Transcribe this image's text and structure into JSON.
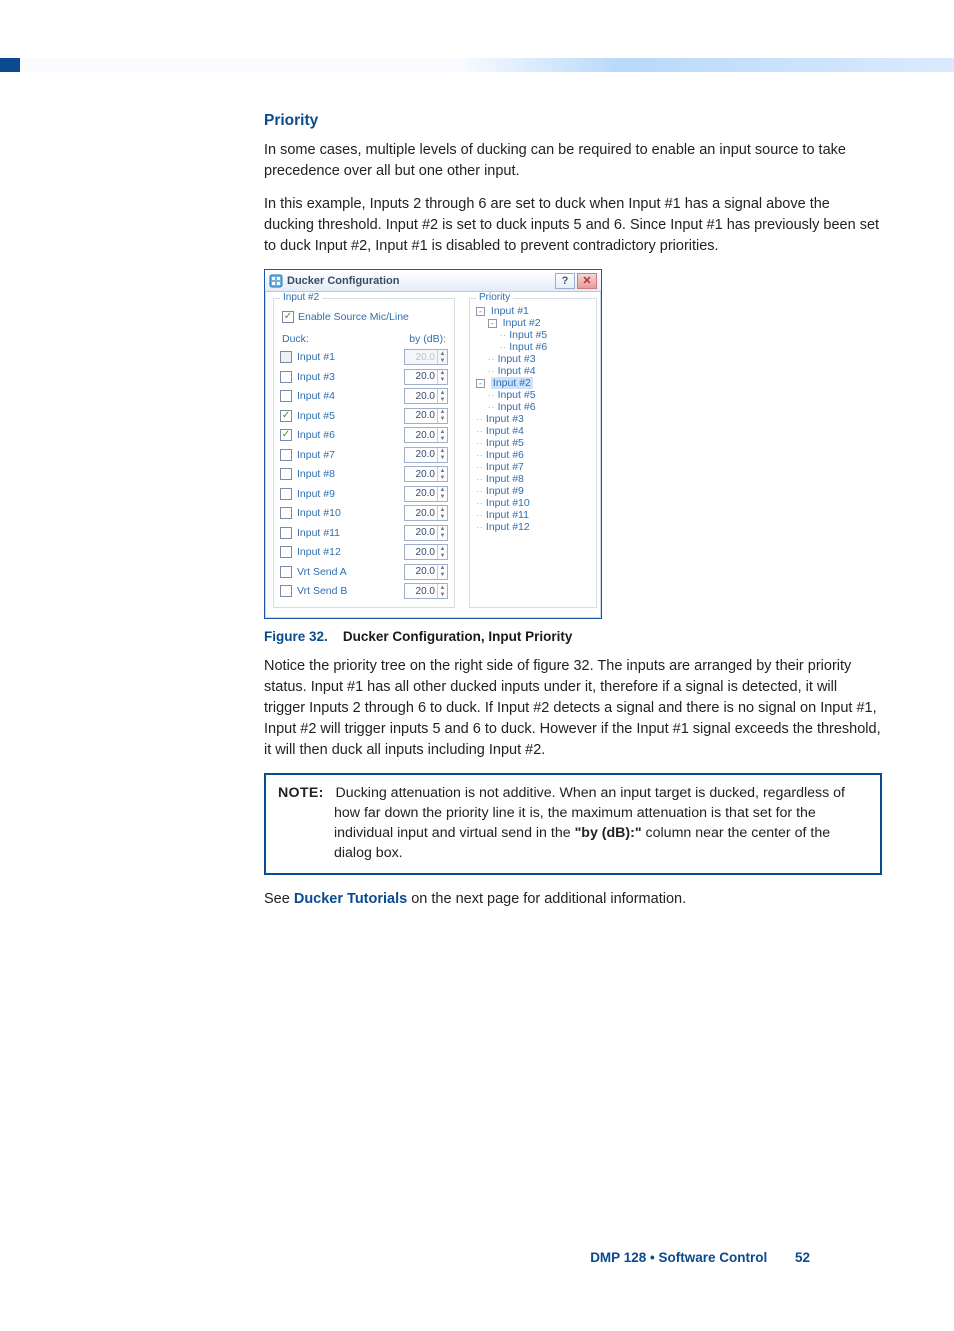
{
  "section_heading": "Priority",
  "para1": "In some cases, multiple levels of ducking can be required to enable an input source to take precedence over all but one other input.",
  "para2": "In this example, Inputs 2 through 6 are set to duck when Input #1 has a signal above the ducking threshold. Input #2 is set to duck inputs 5 and 6. Since Input #1 has previously been set to duck Input #2, Input #1 is disabled to prevent contradictory priorities.",
  "para3": "Notice the priority tree on the right side of figure 32. The inputs are arranged by their priority status. Input #1 has all other ducked inputs under it, therefore if a signal is detected, it will trigger Inputs 2 through 6 to duck. If Input #2 detects a signal and there is no signal on Input #1, Input #2 will trigger inputs 5 and 6 to duck. However if the Input #1 signal exceeds the threshold, it will then duck all inputs including Input #2.",
  "see_prefix": "See ",
  "see_link": "Ducker Tutorials",
  "see_suffix": " on the next page for additional information.",
  "figure": {
    "num": "Figure 32.",
    "title": "Ducker Configuration, Input Priority"
  },
  "note": {
    "label": "NOTE:",
    "body_pre": "Ducking attenuation is not additive. When an input target is ducked, regardless of how far down the priority line it is, the maximum attenuation is that set for the individual input and virtual send in the ",
    "quoted": "\"by (dB):\"",
    "body_post": " column near the center of the dialog box."
  },
  "dialog": {
    "title": "Ducker Configuration",
    "help_glyph": "?",
    "close_glyph": "✕",
    "left": {
      "group_label": "Input #2",
      "enable_label": "Enable Source Mic/Line",
      "enable_checked": true,
      "col_duck": "Duck:",
      "col_by": "by (dB):",
      "rows": [
        {
          "label": "Input #1",
          "value": "20.0",
          "checked": false,
          "disabled": true
        },
        {
          "label": "Input #3",
          "value": "20.0",
          "checked": false,
          "disabled": false
        },
        {
          "label": "Input #4",
          "value": "20.0",
          "checked": false,
          "disabled": false
        },
        {
          "label": "Input #5",
          "value": "20.0",
          "checked": true,
          "disabled": false
        },
        {
          "label": "Input #6",
          "value": "20.0",
          "checked": true,
          "disabled": false
        },
        {
          "label": "Input #7",
          "value": "20.0",
          "checked": false,
          "disabled": false
        },
        {
          "label": "Input #8",
          "value": "20.0",
          "checked": false,
          "disabled": false
        },
        {
          "label": "Input #9",
          "value": "20.0",
          "checked": false,
          "disabled": false
        },
        {
          "label": "Input #10",
          "value": "20.0",
          "checked": false,
          "disabled": false
        },
        {
          "label": "Input #11",
          "value": "20.0",
          "checked": false,
          "disabled": false
        },
        {
          "label": "Input #12",
          "value": "20.0",
          "checked": false,
          "disabled": false
        },
        {
          "label": "Vrt Send A",
          "value": "20.0",
          "checked": false,
          "disabled": false
        },
        {
          "label": "Vrt Send B",
          "value": "20.0",
          "checked": false,
          "disabled": false
        }
      ]
    },
    "right": {
      "group_label": "Priority",
      "tree": [
        {
          "level": 0,
          "expander": "-",
          "label": "Input #1"
        },
        {
          "level": 1,
          "expander": "-",
          "label": "Input #2"
        },
        {
          "level": 2,
          "label": "Input #5"
        },
        {
          "level": 2,
          "label": "Input #6"
        },
        {
          "level": 1,
          "label": "Input #3"
        },
        {
          "level": 1,
          "label": "Input #4"
        },
        {
          "level": 0,
          "expander": "-",
          "label": "Input #2",
          "selected": true
        },
        {
          "level": 1,
          "label": "Input #5"
        },
        {
          "level": 1,
          "label": "Input #6"
        },
        {
          "level": 0,
          "label": "Input #3"
        },
        {
          "level": 0,
          "label": "Input #4"
        },
        {
          "level": 0,
          "label": "Input #5"
        },
        {
          "level": 0,
          "label": "Input #6"
        },
        {
          "level": 0,
          "label": "Input #7"
        },
        {
          "level": 0,
          "label": "Input #8"
        },
        {
          "level": 0,
          "label": "Input #9"
        },
        {
          "level": 0,
          "label": "Input #10"
        },
        {
          "level": 0,
          "label": "Input #11"
        },
        {
          "level": 0,
          "label": "Input #12"
        }
      ]
    }
  },
  "footer": {
    "product": "DMP 128 • Software Control",
    "page": "52"
  }
}
